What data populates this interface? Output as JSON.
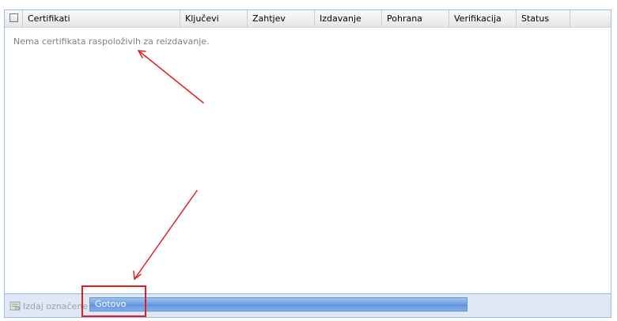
{
  "grid": {
    "columns": [
      "Certifikati",
      "Ključevi",
      "Zahtjev",
      "Izdavanje",
      "Pohrana",
      "Verifikacija",
      "Status"
    ],
    "empty_message": "Nema certifikata raspoloživih za reizdavanje."
  },
  "toolbar": {
    "issue_selected_label": "Izdaj označene",
    "issue_selected_enabled": false
  },
  "progress": {
    "text": "Gotovo",
    "value": 1.0
  },
  "annotations": {
    "color": "#e02020"
  },
  "colors": {
    "border": "#99bbe8",
    "footer_bg": "#dfe8f6",
    "progress_fill": "#6f9fe0"
  }
}
